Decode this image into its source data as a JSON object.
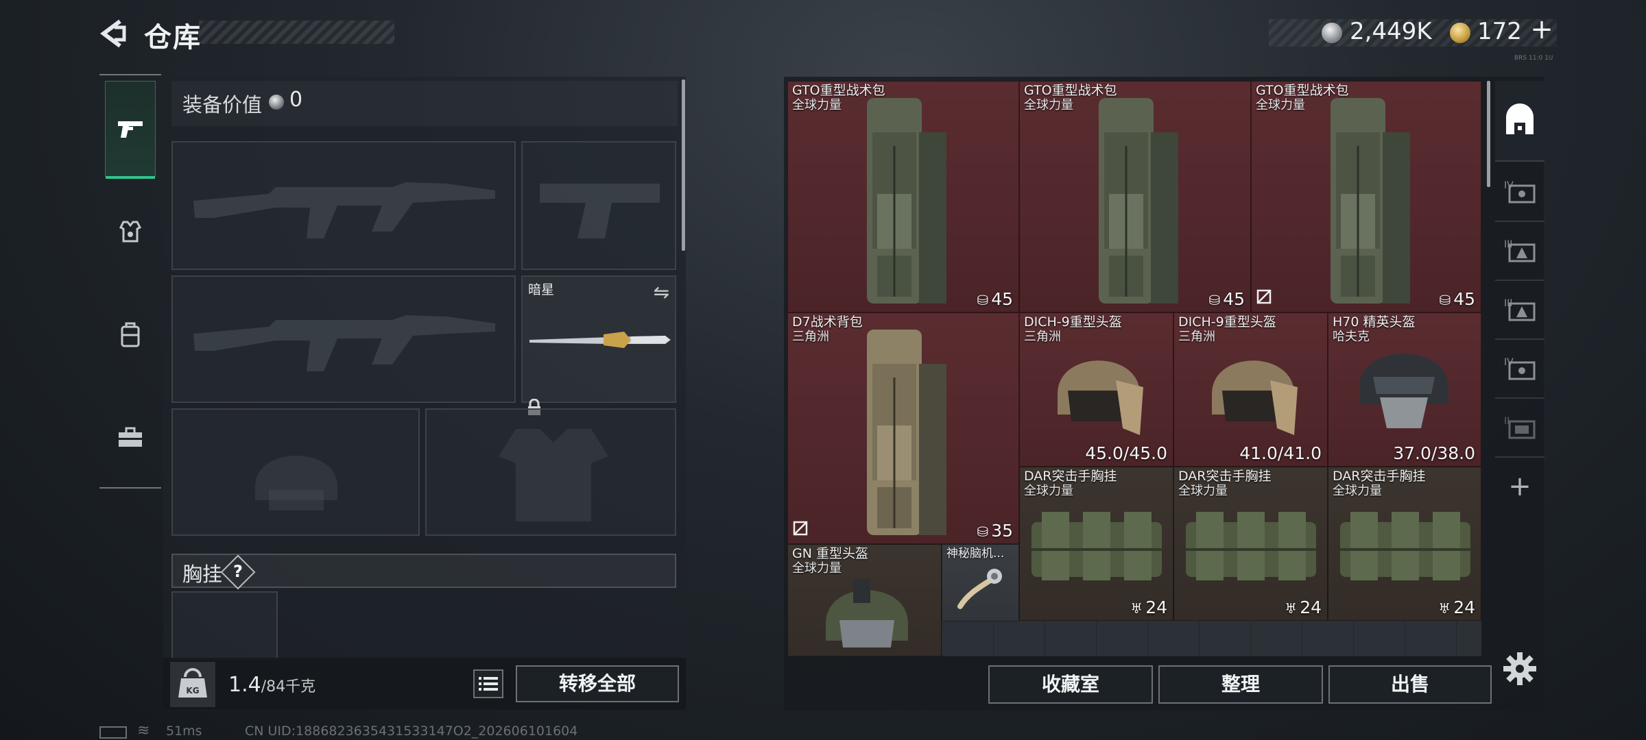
{
  "header": {
    "title": "仓库",
    "silver_amount": "2,449K",
    "gold_amount": "172",
    "plus_label": "+",
    "tiny_code": "BRS 11:0 1U"
  },
  "nav": {
    "tabs": [
      {
        "name": "weapons",
        "icon": "pistol-icon",
        "active": true
      },
      {
        "name": "armor",
        "icon": "armor-icon",
        "active": false
      },
      {
        "name": "backpack",
        "icon": "backpack-icon",
        "active": false
      },
      {
        "name": "toolbox",
        "icon": "toolbox-icon",
        "active": false
      }
    ]
  },
  "equipment": {
    "value_label": "装备价值",
    "value": "0",
    "knife_name": "暗星",
    "chest_label": "胸挂",
    "help_label": "?",
    "weight_current": "1.4",
    "weight_max": "/84千克",
    "transfer_all_label": "转移全部"
  },
  "status": {
    "ping": "51ms",
    "uid": "CN UID:1886823635431533147O2_202606101604"
  },
  "container": {
    "items": [
      {
        "id": "gto1",
        "name": "GTO重型战术包",
        "sub": "全球力量",
        "value": "45",
        "color": "red"
      },
      {
        "id": "gto2",
        "name": "GTO重型战术包",
        "sub": "全球力量",
        "value": "45",
        "color": "red"
      },
      {
        "id": "gto3",
        "name": "GTO重型战术包",
        "sub": "全球力量",
        "value": "45",
        "color": "red"
      },
      {
        "id": "d7",
        "name": "D7战术背包",
        "sub": "三角洲",
        "value": "35",
        "color": "red"
      },
      {
        "id": "dich1",
        "name": "DICH-9重型头盔",
        "sub": "三角洲",
        "value": "45.0/45.0",
        "color": "red"
      },
      {
        "id": "dich2",
        "name": "DICH-9重型头盔",
        "sub": "三角洲",
        "value": "41.0/41.0",
        "color": "red"
      },
      {
        "id": "h70",
        "name": "H70 精英头盔",
        "sub": "哈夫克",
        "value": "37.0/38.0",
        "color": "red"
      },
      {
        "id": "dar1",
        "name": "DAR突击手胸挂",
        "sub": "全球力量",
        "value": "24",
        "color": "brown"
      },
      {
        "id": "dar2",
        "name": "DAR突击手胸挂",
        "sub": "全球力量",
        "value": "24",
        "color": "brown"
      },
      {
        "id": "dar3",
        "name": "DAR突击手胸挂",
        "sub": "全球力量",
        "value": "24",
        "color": "brown"
      },
      {
        "id": "gn",
        "name": "GN 重型头盔",
        "sub": "全球力量",
        "value": "",
        "color": "brown"
      },
      {
        "id": "brain",
        "name": "神秘脑机...",
        "sub": "",
        "value": "",
        "color": "grey"
      }
    ]
  },
  "right_tabs": {
    "add_label": "+"
  },
  "actions": {
    "collection_label": "收藏室",
    "sort_label": "整理",
    "sell_label": "出售"
  },
  "colors": {
    "accent_green": "#33c28e",
    "item_red": "#5a2c30",
    "item_brown": "#3c342e"
  }
}
